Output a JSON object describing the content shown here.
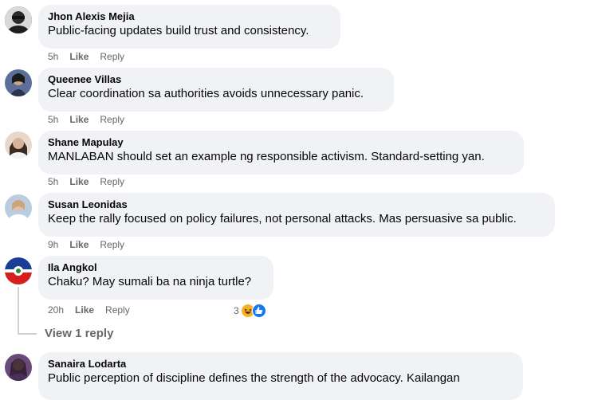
{
  "comments": [
    {
      "author": "Jhon Alexis Mejia",
      "text": "Public-facing updates build trust and consistency.",
      "time": "5h",
      "like": "Like",
      "reply": "Reply"
    },
    {
      "author": "Queenee Villas",
      "text": "Clear coordination sa authorities avoids unnecessary panic.",
      "time": "5h",
      "like": "Like",
      "reply": "Reply"
    },
    {
      "author": "Shane Mapulay",
      "text": "MANLABAN should set an example ng responsible activism. Standard-setting yan.",
      "time": "5h",
      "like": "Like",
      "reply": "Reply"
    },
    {
      "author": "Susan Leonidas",
      "text": "Keep the rally focused on policy failures, not personal attacks. Mas persuasive sa public.",
      "time": "9h",
      "like": "Like",
      "reply": "Reply"
    },
    {
      "author": "Ila Angkol",
      "text": "Chaku? May sumali ba na ninja turtle?",
      "time": "20h",
      "like": "Like",
      "reply": "Reply",
      "reaction_count": "3",
      "reaction_icons": [
        "haha-icon",
        "like-reaction-icon"
      ]
    },
    {
      "author": "Sanaira Lodarta",
      "text": "Public perception of discipline defines the strength of the advocacy. Kailangan"
    }
  ],
  "view_replies_label": "View 1 reply",
  "colors": {
    "bubble": "#f0f2f5",
    "meta": "#65676b",
    "text": "#050505"
  }
}
